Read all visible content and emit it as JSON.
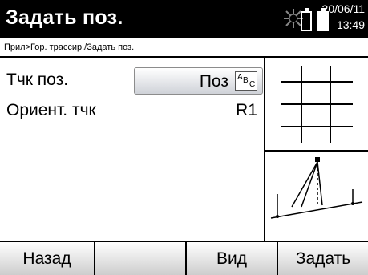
{
  "header": {
    "title": "Задать поз.",
    "date": "20/06/11",
    "time": "13:49",
    "icons": [
      "sun-icon",
      "battery-icon",
      "battery-icon"
    ]
  },
  "breadcrumb": "Прил>Гор. трассир./Задать поз.",
  "fields": {
    "point_label": "Тчк поз.",
    "point_value": "Поз",
    "input_mode": {
      "a": "A",
      "b": "B",
      "c": "C"
    },
    "orient_label": "Ориент. тчк",
    "orient_value": "R1"
  },
  "softkeys": {
    "back": "Назад",
    "empty": "",
    "view": "Вид",
    "set": "Задать"
  },
  "colors": {
    "titlebar": "#000000",
    "background": "#ffffff"
  }
}
